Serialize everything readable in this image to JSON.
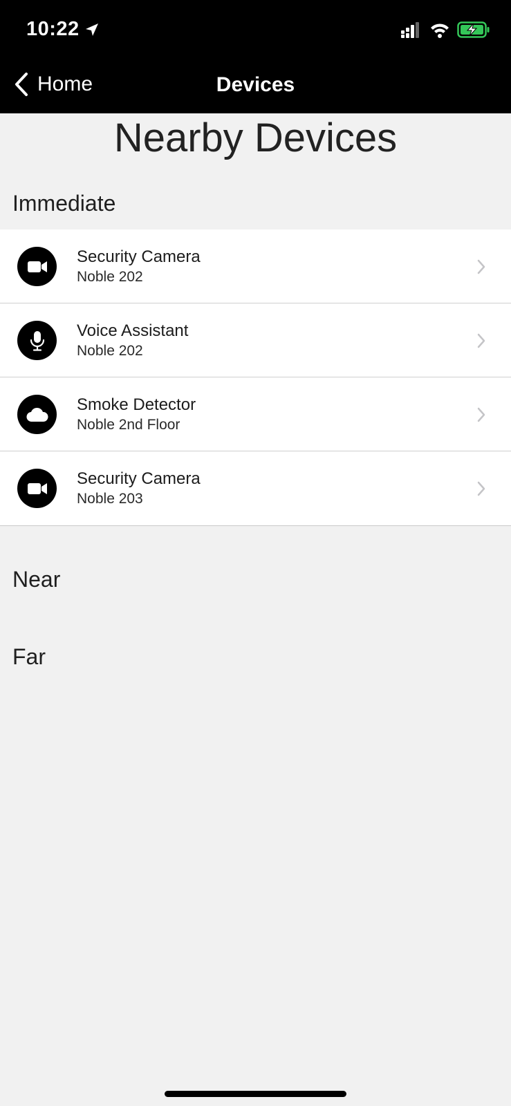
{
  "status_bar": {
    "time": "10:22",
    "icons": [
      "location-arrow-icon",
      "signal-icon",
      "wifi-icon",
      "battery-charging-icon"
    ],
    "battery_color": "#34c759"
  },
  "nav": {
    "back_label": "Home",
    "title": "Devices"
  },
  "page": {
    "title": "Nearby Devices"
  },
  "sections": {
    "immediate": "Immediate",
    "near": "Near",
    "far": "Far"
  },
  "devices": [
    {
      "name": "Security Camera",
      "location": "Noble 202",
      "icon": "video-camera-icon"
    },
    {
      "name": "Voice Assistant",
      "location": "Noble 202",
      "icon": "microphone-icon"
    },
    {
      "name": "Smoke Detector",
      "location": "Noble 2nd Floor",
      "icon": "cloud-icon"
    },
    {
      "name": "Security Camera",
      "location": "Noble 203",
      "icon": "video-camera-icon"
    }
  ]
}
